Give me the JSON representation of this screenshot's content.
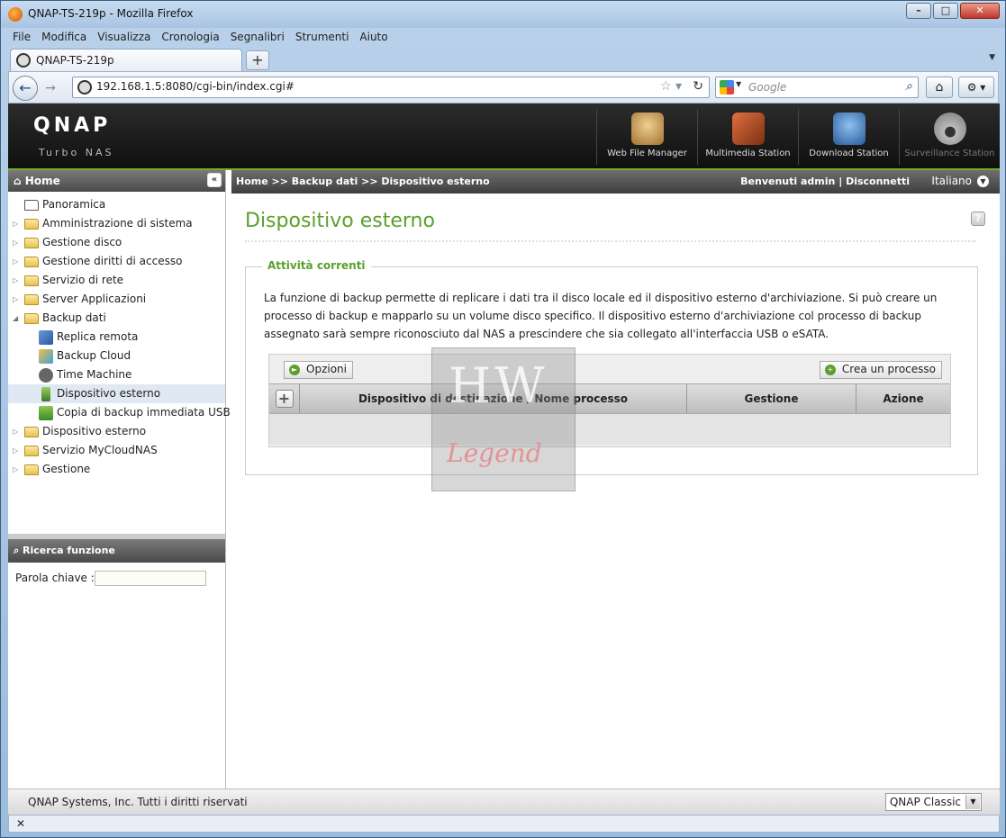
{
  "window": {
    "title": "QNAP-TS-219p - Mozilla Firefox",
    "minimize": "–",
    "maximize": "□",
    "close": "✕"
  },
  "menu": [
    "File",
    "Modifica",
    "Visualizza",
    "Cronologia",
    "Segnalibri",
    "Strumenti",
    "Aiuto"
  ],
  "tab": {
    "title": "QNAP-TS-219p",
    "new_tab": "+"
  },
  "navbar": {
    "url": "192.168.1.5:8080/cgi-bin/index.cgi#",
    "search_placeholder": "Google"
  },
  "qnap": {
    "logo": "QNAP",
    "subtitle": "Turbo NAS",
    "apps": [
      {
        "label": "Web File Manager",
        "color": "#c8a060"
      },
      {
        "label": "Multimedia Station",
        "color": "#c05030"
      },
      {
        "label": "Download Station",
        "color": "#3a7ac8"
      },
      {
        "label": "Surveillance Station",
        "color": "#888888"
      }
    ]
  },
  "sidebar": {
    "header": "Home",
    "collapse": "«",
    "items": [
      {
        "label": "Panoramica",
        "kind": "leaf-top"
      },
      {
        "label": "Amministrazione di sistema",
        "kind": "folder"
      },
      {
        "label": "Gestione disco",
        "kind": "folder"
      },
      {
        "label": "Gestione diritti di accesso",
        "kind": "folder"
      },
      {
        "label": "Servizio di rete",
        "kind": "folder"
      },
      {
        "label": "Server Applicazioni",
        "kind": "folder"
      },
      {
        "label": "Backup dati",
        "kind": "folder-open"
      },
      {
        "label": "Replica remota",
        "kind": "child"
      },
      {
        "label": "Backup Cloud",
        "kind": "child"
      },
      {
        "label": "Time Machine",
        "kind": "child"
      },
      {
        "label": "Dispositivo esterno",
        "kind": "child",
        "selected": true
      },
      {
        "label": "Copia di backup immediata USB",
        "kind": "child"
      },
      {
        "label": "Dispositivo esterno",
        "kind": "folder"
      },
      {
        "label": "Servizio MyCloudNAS",
        "kind": "folder"
      },
      {
        "label": "Gestione",
        "kind": "folder"
      }
    ],
    "search_header": "Ricerca funzione",
    "search_label": "Parola chiave :"
  },
  "breadcrumb": {
    "path": "Home >> Backup dati >> Dispositivo esterno",
    "welcome": "Benvenuti admin",
    "separator": "|",
    "logout": "Disconnetti",
    "language": "Italiano"
  },
  "main": {
    "title": "Dispositivo esterno",
    "help": "?",
    "section": "Attività correnti",
    "description": "La funzione di backup permette di replicare i dati tra il disco locale ed il dispositivo esterno d'archiviazione. Si può creare un processo di backup e mapparlo su un volume disco specifico. Il dispositivo esterno d'archiviazione col processo di backup assegnato sarà sempre riconosciuto dal NAS a prescindere che sia collegato all'interfaccia USB o eSATA.",
    "options_button": "Opzioni",
    "create_button": "Crea un processo",
    "columns": [
      "Dispositivo di destinazione / Nome processo",
      "Gestione",
      "Azione"
    ]
  },
  "watermark": {
    "top": "HW",
    "bottom": "Legend"
  },
  "footer": {
    "copyright": "QNAP Systems, Inc. Tutti i diritti riservati",
    "theme": "QNAP Classic"
  },
  "statusbar": {
    "close": "✕"
  },
  "colors": {
    "accent_green": "#5aa02c"
  }
}
